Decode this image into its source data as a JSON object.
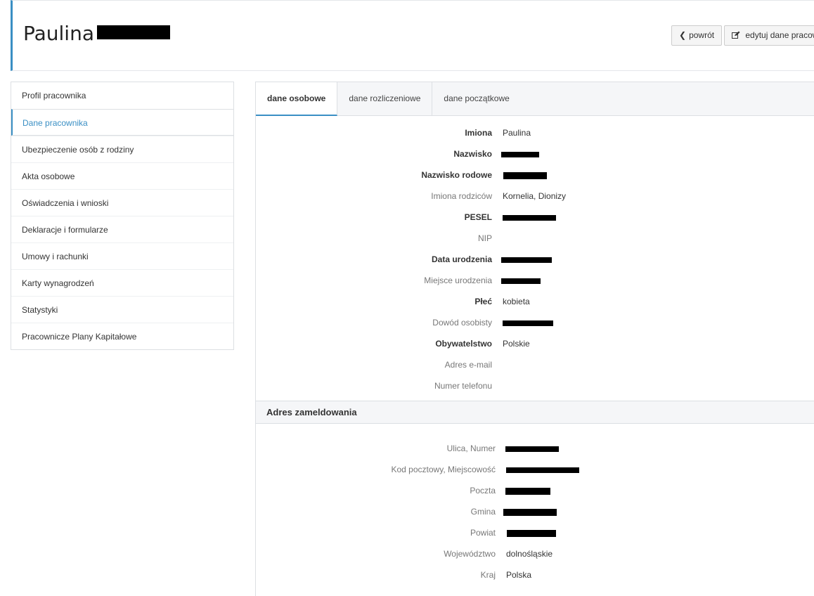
{
  "header": {
    "name": "Paulina",
    "back_label": "powrót",
    "edit_label": "edytuj dane pracownika"
  },
  "sidebar": {
    "items": [
      {
        "label": "Profil pracownika",
        "active": false
      },
      {
        "label": "Dane pracownika",
        "active": true
      },
      {
        "label": "Ubezpieczenie osób z rodziny",
        "active": false
      },
      {
        "label": "Akta osobowe",
        "active": false
      },
      {
        "label": "Oświadczenia i wnioski",
        "active": false
      },
      {
        "label": "Deklaracje i formularze",
        "active": false
      },
      {
        "label": "Umowy i rachunki",
        "active": false
      },
      {
        "label": "Karty wynagrodzeń",
        "active": false
      },
      {
        "label": "Statystyki",
        "active": false
      },
      {
        "label": "Pracownicze Plany Kapitałowe",
        "active": false
      }
    ]
  },
  "tabs": [
    {
      "label": "dane osobowe",
      "active": true
    },
    {
      "label": "dane rozliczeniowe",
      "active": false
    },
    {
      "label": "dane początkowe",
      "active": false
    }
  ],
  "personal": {
    "imiona_label": "Imiona",
    "imiona_value": "Paulina",
    "nazwisko_label": "Nazwisko",
    "nazwisko_rodowe_label": "Nazwisko rodowe",
    "imiona_rodzicow_label": "Imiona rodziców",
    "imiona_rodzicow_value": "Kornelia, Dionizy",
    "pesel_label": "PESEL",
    "nip_label": "NIP",
    "data_urodzenia_label": "Data urodzenia",
    "miejsce_urodzenia_label": "Miejsce urodzenia",
    "plec_label": "Płeć",
    "plec_value": "kobieta",
    "dowod_label": "Dowód osobisty",
    "obywatelstwo_label": "Obywatelstwo",
    "obywatelstwo_value": "Polskie",
    "email_label": "Adres e-mail",
    "telefon_label": "Numer telefonu"
  },
  "address": {
    "section_title": "Adres zameldowania",
    "ulica_label": "Ulica, Numer",
    "kod_label": "Kod pocztowy, Miejscowość",
    "poczta_label": "Poczta",
    "gmina_label": "Gmina",
    "powiat_label": "Powiat",
    "wojewodztwo_label": "Województwo",
    "wojewodztwo_value": "dolnośląskie",
    "kraj_label": "Kraj",
    "kraj_value": "Polska"
  },
  "colors": {
    "accent": "#3a8fc4",
    "redaction": "#000000"
  },
  "icons": {
    "back": "chevron-left-icon",
    "edit": "edit-icon"
  }
}
